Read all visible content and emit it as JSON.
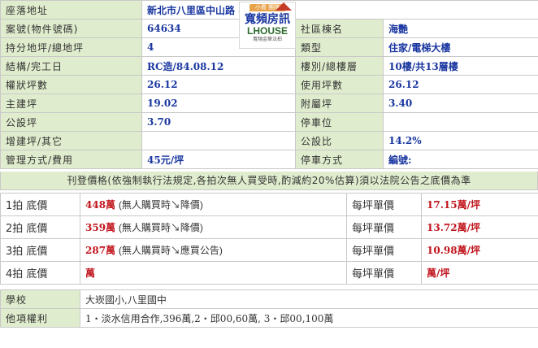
{
  "info": {
    "address_label": "座落地址",
    "address_value": "新北市八里區中山路     8號10樓",
    "case_label": "案號(物件號碼)",
    "case_value": "64634",
    "community_label": "社區棟名",
    "community_value": "海艷",
    "land_label": "持分地坪/總地坪",
    "land_value": "4",
    "type_label": "類型",
    "type_value": "住家/電梯大樓",
    "structure_label": "結構/完工日",
    "structure_value": "RC造/84.08.12",
    "floor_label": "樓別/總樓層",
    "floor_value": "10樓/共13層樓",
    "title_area_label": "權狀坪數",
    "title_area_value": "26.12",
    "use_area_label": "使用坪數",
    "use_area_value": "26.12",
    "main_label": "主建坪",
    "main_value": "19.02",
    "annex_label": "附屬坪",
    "annex_value": "3.40",
    "public_label": "公設坪",
    "public_value": "3.70",
    "parking_label": "停車位",
    "parking_value": "",
    "extra_label": "增建坪/其它",
    "extra_value": "",
    "public_ratio_label": "公設比",
    "public_ratio_value": "14.2%",
    "mgmt_label": "管理方式/費用",
    "mgmt_value": "45元/坪",
    "park_method_label": "停車方式",
    "park_method_value": "編號:"
  },
  "logo": {
    "top_text": "小資 團隊",
    "name": "寬頻房訊",
    "en": "LHOUSE",
    "sub": "寬頻金華法拍"
  },
  "notice": "刊登價格(依強制執行法規定,各拍次無人買受時,酌減約20%估算)須以法院公告之底價為準",
  "auctions": [
    {
      "label": "1拍 底價",
      "price": "448萬",
      "note": "(無人購買時↘降價)",
      "unit_label": "每坪單價",
      "unit_price": "17.15萬/坪"
    },
    {
      "label": "2拍 底價",
      "price": "359萬",
      "note": "(無人購買時↘降價)",
      "unit_label": "每坪單價",
      "unit_price": "13.72萬/坪"
    },
    {
      "label": "3拍 底價",
      "price": "287萬",
      "note": "(無人購買時↘應買公告)",
      "unit_label": "每坪單價",
      "unit_price": "10.98萬/坪"
    },
    {
      "label": "4拍 底價",
      "price": "萬",
      "note": "",
      "unit_label": "每坪單價",
      "unit_price": "萬/坪"
    }
  ],
  "bottom": {
    "school_label": "學校",
    "school_value": "大崁國小,八里國中",
    "rights_label": "他項權利",
    "rights_value": "1・淡水信用合作,396萬,2・邱00,60萬,  3・邱00,100萬"
  },
  "colors": {
    "label_bg": "#dfeccd",
    "value_blue": "#1a37a0",
    "price_red": "#c0141c"
  }
}
